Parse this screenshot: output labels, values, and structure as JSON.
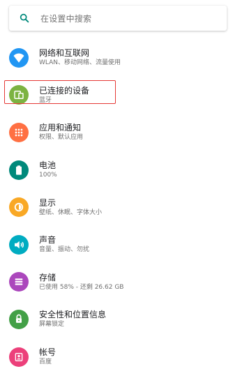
{
  "search": {
    "placeholder": "在设置中搜索",
    "icon": "search-icon"
  },
  "settings_items": [
    {
      "title": "网络和互联网",
      "subtitle": "WLAN、移动网络、流量使用",
      "icon": "wifi-icon",
      "color": "#2196f3"
    },
    {
      "title": "已连接的设备",
      "subtitle": "蓝牙",
      "icon": "devices-icon",
      "color": "#7cb342"
    },
    {
      "title": "应用和通知",
      "subtitle": "权限、默认应用",
      "icon": "apps-icon",
      "color": "#ff7043"
    },
    {
      "title": "电池",
      "subtitle": "100%",
      "icon": "battery-icon",
      "color": "#00897b"
    },
    {
      "title": "显示",
      "subtitle": "壁纸、休眠、字体大小",
      "icon": "display-icon",
      "color": "#f9a825"
    },
    {
      "title": "声音",
      "subtitle": "音量、振动、勿扰",
      "icon": "sound-icon",
      "color": "#00acc1"
    },
    {
      "title": "存储",
      "subtitle": "已使用 58% - 还剩 26.62 GB",
      "icon": "storage-icon",
      "color": "#ab47bc"
    },
    {
      "title": "安全性和位置信息",
      "subtitle": "屏幕锁定",
      "icon": "lock-icon",
      "color": "#43a047"
    },
    {
      "title": "帐号",
      "subtitle": "百度",
      "icon": "account-icon",
      "color": "#ec407a"
    }
  ],
  "highlight": {
    "target": "应用和通知",
    "color": "#e53935"
  },
  "colors": {
    "accent": "#00897b"
  }
}
